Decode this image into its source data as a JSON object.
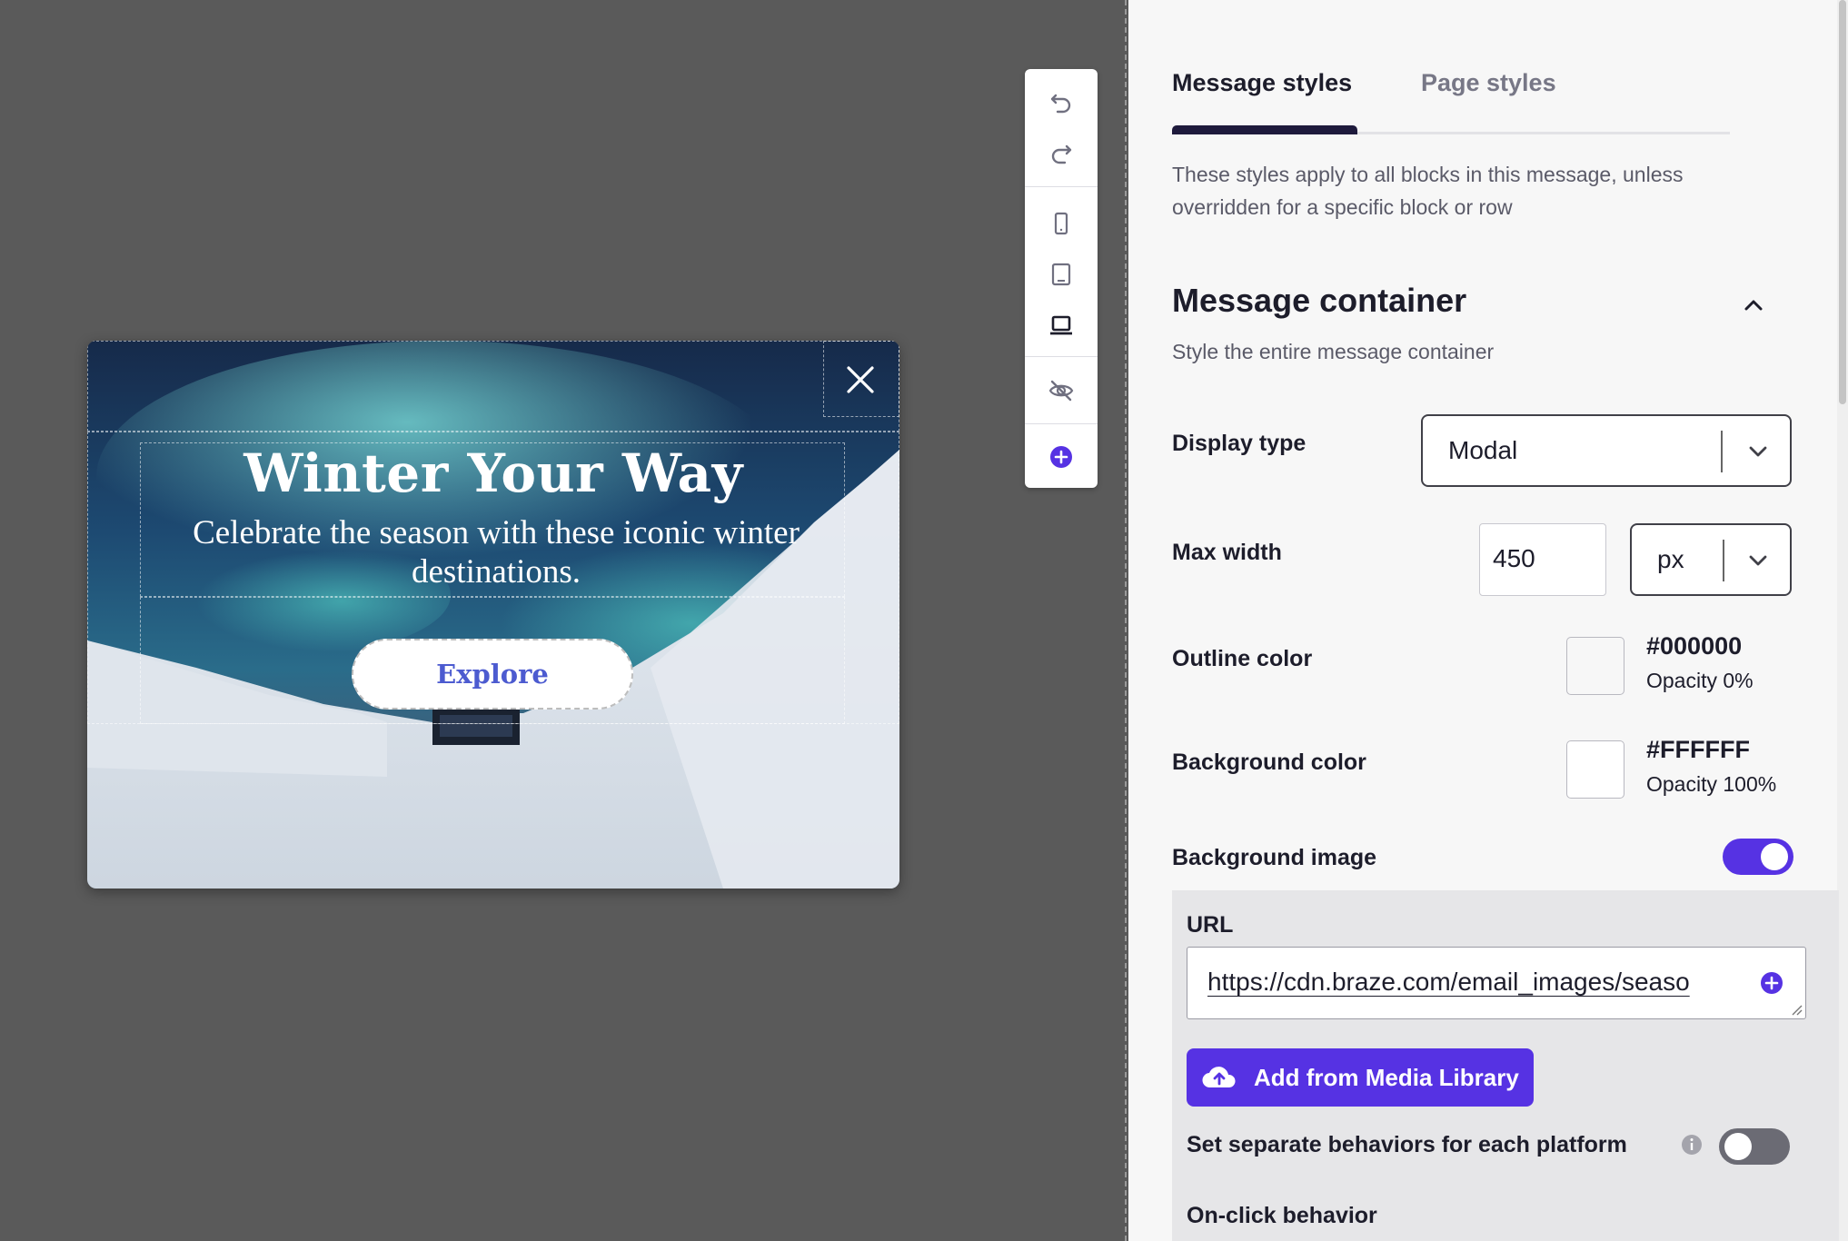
{
  "modal": {
    "title": "Winter Your Way",
    "subtitle": "Celebrate the season with these iconic winter destinations.",
    "button_label": "Explore"
  },
  "toolbar": {
    "icons": [
      "undo-icon",
      "redo-icon",
      "mobile-icon",
      "tablet-icon",
      "desktop-icon",
      "hide-icon",
      "add-icon"
    ]
  },
  "panel": {
    "tabs": [
      {
        "label": "Message styles",
        "active": true
      },
      {
        "label": "Page styles",
        "active": false
      }
    ],
    "description": "These styles apply to all blocks in this message, unless overridden for a specific block or row",
    "section": {
      "title": "Message container",
      "subtitle": "Style the entire message container"
    },
    "display_type": {
      "label": "Display type",
      "value": "Modal"
    },
    "max_width": {
      "label": "Max width",
      "value": "450",
      "unit": "px"
    },
    "outline_color": {
      "label": "Outline color",
      "hex": "#000000",
      "opacity": "Opacity 0%"
    },
    "background_color": {
      "label": "Background color",
      "hex": "#FFFFFF",
      "opacity": "Opacity 100%"
    },
    "background_image": {
      "label": "Background image",
      "enabled": true
    },
    "url": {
      "label": "URL",
      "value": "https://cdn.braze.com/email_images/seaso"
    },
    "media_button": "Add from Media Library",
    "separate_behaviors": {
      "label": "Set separate behaviors for each platform",
      "enabled": false
    },
    "onclick_label": "On-click behavior"
  },
  "colors": {
    "accent": "#5632e3",
    "tab_underline": "#1e1a3c",
    "explore_text": "#4c5bd0",
    "canvas_bg": "#5a5a5a"
  }
}
